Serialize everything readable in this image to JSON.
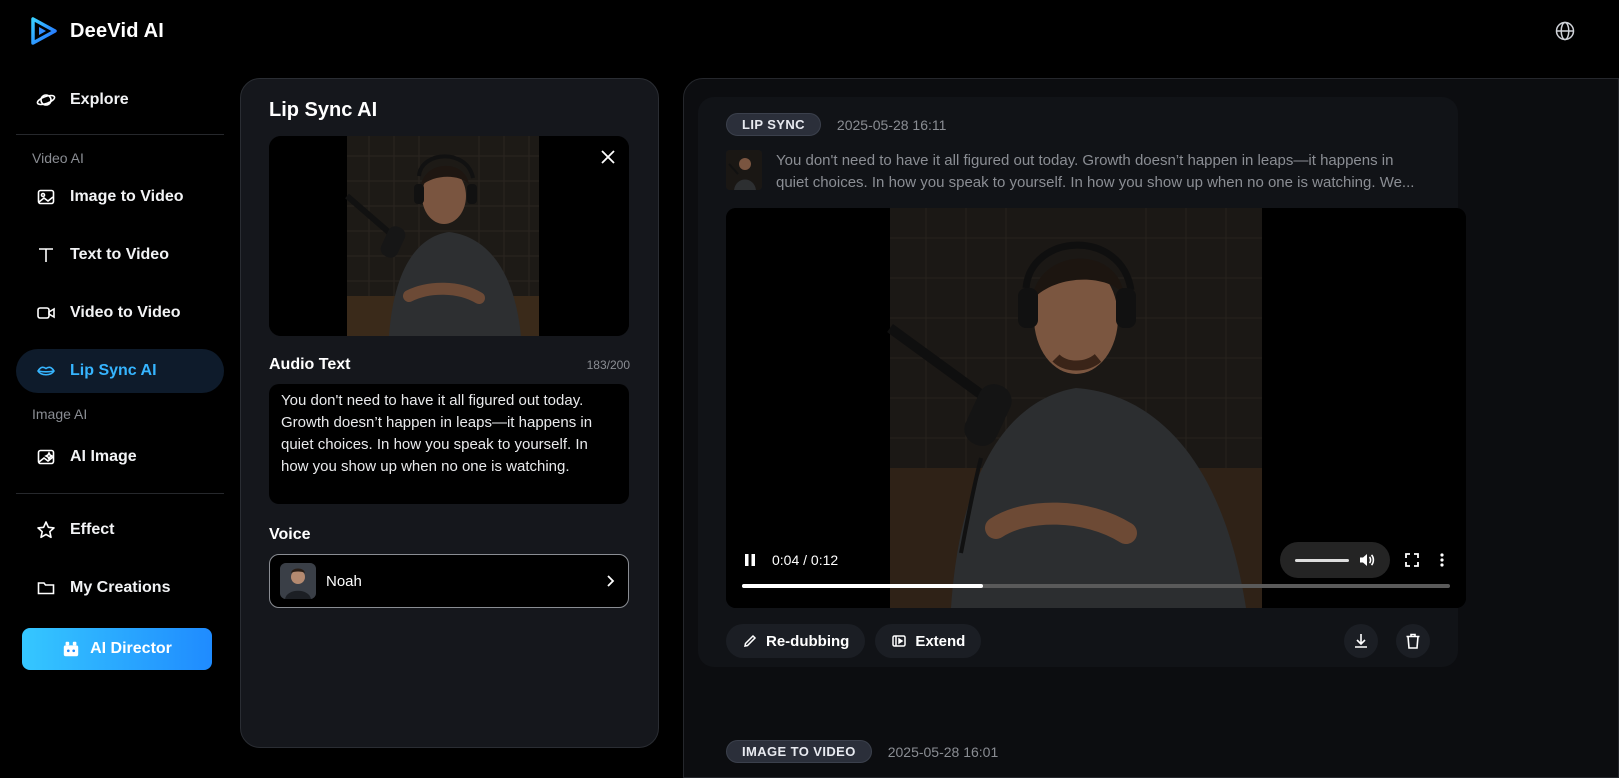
{
  "app": {
    "name": "DeeVid AI"
  },
  "sidebar": {
    "explore": "Explore",
    "video_section": "Video AI",
    "video_items": [
      {
        "label": "Image to Video",
        "icon": "image-icon"
      },
      {
        "label": "Text to Video",
        "icon": "text-icon"
      },
      {
        "label": "Video to Video",
        "icon": "video-camera-icon"
      },
      {
        "label": "Lip Sync AI",
        "icon": "lips-icon",
        "active": true
      }
    ],
    "image_section": "Image AI",
    "ai_image": "AI Image",
    "effect": "Effect",
    "my_creations": "My Creations",
    "ai_director": "AI Director"
  },
  "panel": {
    "title": "Lip Sync AI",
    "audio_text_label": "Audio Text",
    "counter": "183/200",
    "audio_text": "You don't need to have it all figured out today. Growth doesn’t happen in leaps—it happens in quiet choices. In how you speak to yourself. In how you show up when no one is watching.",
    "voice_label": "Voice",
    "voice_name": "Noah"
  },
  "result": {
    "tag": "LIP SYNC",
    "date": "2025-05-28 16:11",
    "prompt_line1": "You don't need to have it all figured out today. Growth doesn’t happen in leaps—it happens in",
    "prompt_line2": "quiet choices. In how you speak to yourself. In how you show up when no one is watching. We...",
    "time": "0:04 / 0:12",
    "progress": 0.34,
    "actions": {
      "redub": "Re-dubbing",
      "extend": "Extend"
    }
  },
  "next": {
    "tag": "IMAGE TO VIDEO",
    "date": "2025-05-28 16:01"
  },
  "colors": {
    "accent": "#36b5ff",
    "brand_gradient_start": "#35c7ff",
    "brand_gradient_end": "#1f8bff"
  }
}
